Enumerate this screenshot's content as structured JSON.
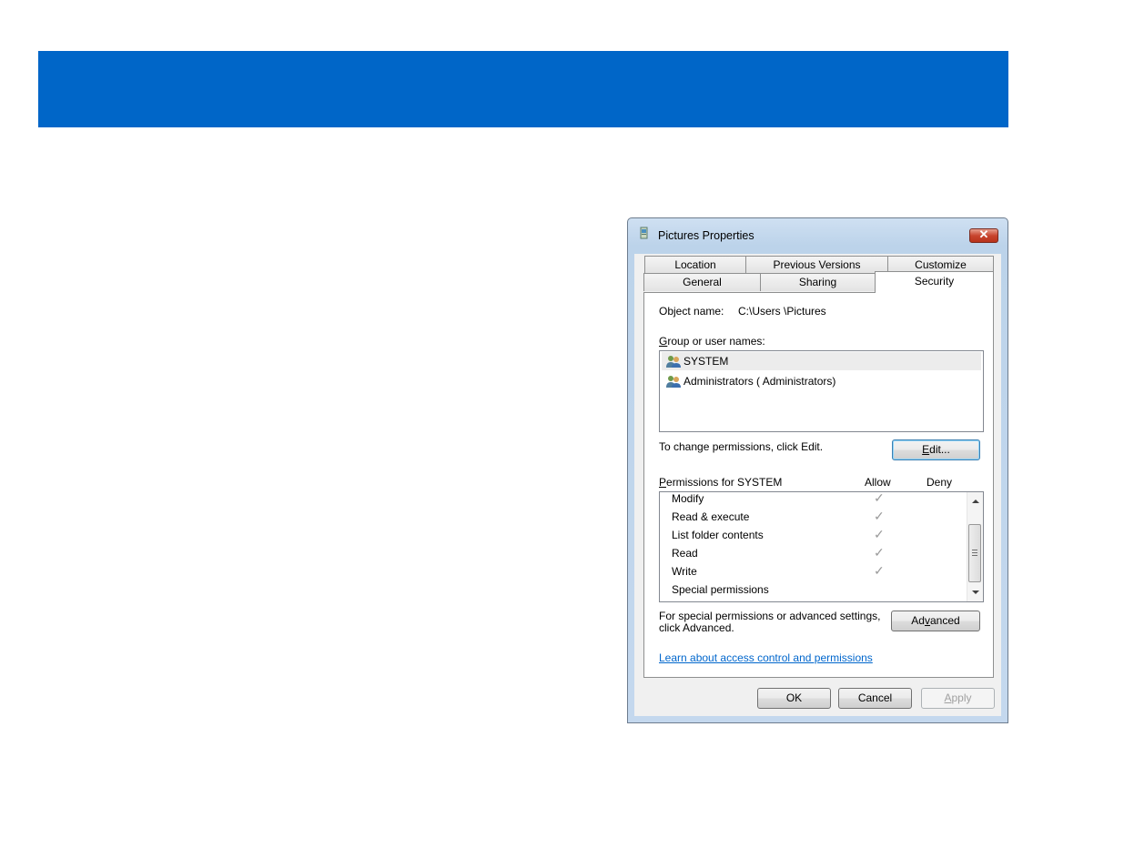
{
  "dialog": {
    "title": "Pictures Properties",
    "close_glyph": "✕",
    "tabs_row1": [
      "Location",
      "Previous Versions",
      "Customize"
    ],
    "tabs_row2": [
      "General",
      "Sharing",
      "Security"
    ],
    "active_tab": "Security"
  },
  "security": {
    "object_name_label": "Object name:",
    "object_name_value": "C:\\Users \\Pictures",
    "group_label_accel": "G",
    "group_label_rest": "roup or user names:",
    "users": [
      {
        "name": "SYSTEM",
        "icon": "users-icon",
        "selected": true
      },
      {
        "name": "Administrators ( Administrators)",
        "icon": "users-icon",
        "selected": false
      }
    ],
    "change_text": "To change permissions, click Edit.",
    "edit_button_accel": "E",
    "edit_button_rest": "dit...",
    "permissions_accel": "P",
    "permissions_rest": "ermissions for SYSTEM",
    "allow_header": "Allow",
    "deny_header": "Deny",
    "permissions": [
      {
        "name": "Modify",
        "allow": true,
        "deny": false
      },
      {
        "name": "Read & execute",
        "allow": true,
        "deny": false
      },
      {
        "name": "List folder contents",
        "allow": true,
        "deny": false
      },
      {
        "name": "Read",
        "allow": true,
        "deny": false
      },
      {
        "name": "Write",
        "allow": true,
        "deny": false
      },
      {
        "name": "Special permissions",
        "allow": false,
        "deny": false
      }
    ],
    "check_glyph": "✓",
    "advanced_text_line1": "For special permissions or advanced settings,",
    "advanced_text_line2": "click Advanced.",
    "advanced_button_pre": "Ad",
    "advanced_button_accel": "v",
    "advanced_button_post": "anced",
    "learn_link": "Learn about access control and permissions"
  },
  "footer": {
    "ok": "OK",
    "cancel": "Cancel",
    "apply_accel": "A",
    "apply_rest": "pply"
  },
  "colors": {
    "banner": "#0066c8",
    "link": "#0066cc"
  }
}
